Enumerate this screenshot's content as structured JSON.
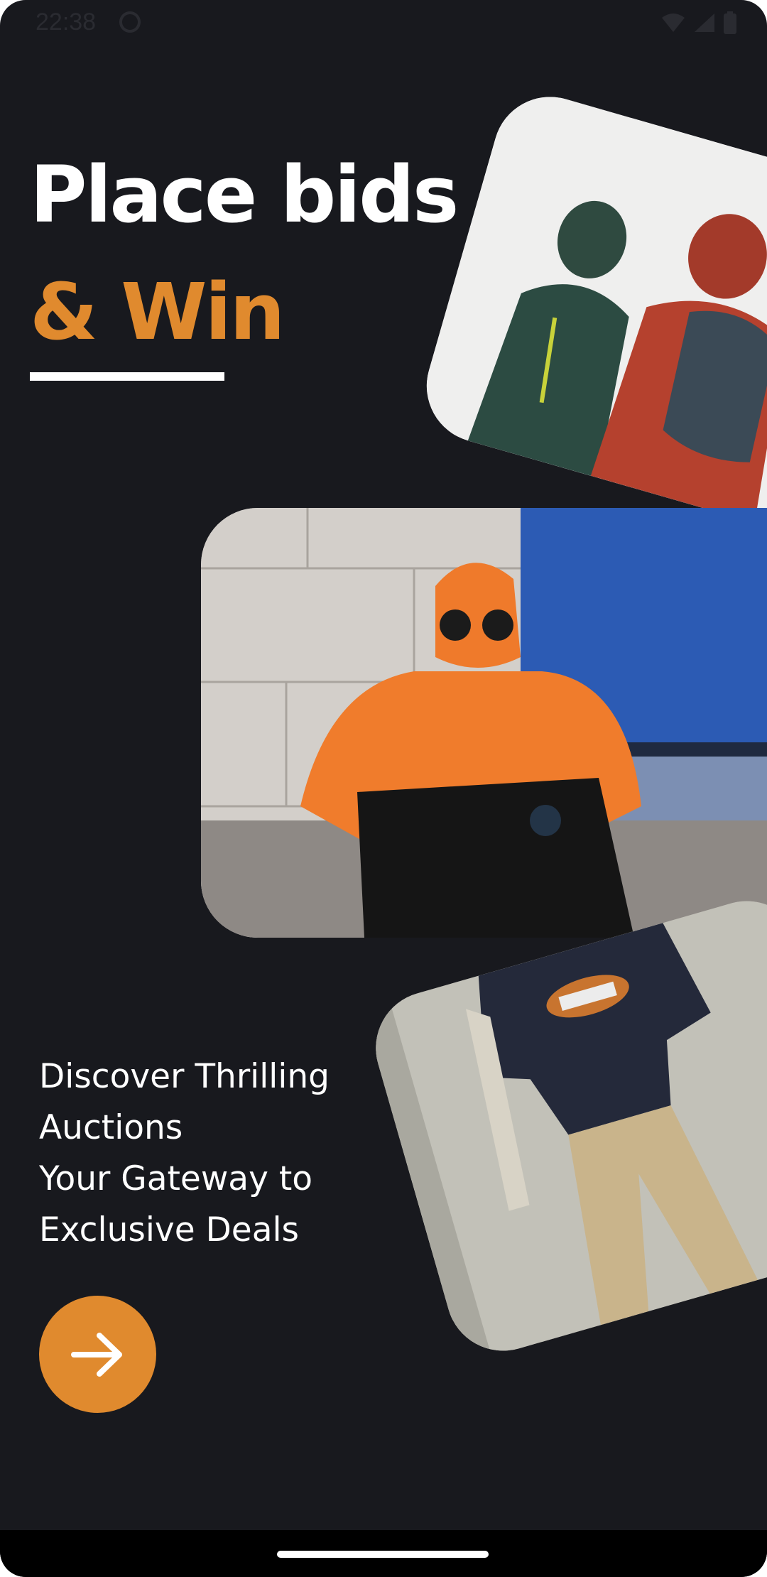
{
  "status_bar": {
    "time": "22:38",
    "icons": [
      "app-notification-icon",
      "wifi-icon",
      "cellular-signal-icon",
      "battery-icon"
    ]
  },
  "headline": {
    "line1": "Place bids",
    "line2": "& Win"
  },
  "tagline": {
    "line1": "Discover Thrilling",
    "line2": "Auctions",
    "line3": "Your Gateway to",
    "line4": "Exclusive Deals"
  },
  "next_button": {
    "icon": "arrow-right-icon"
  },
  "colors": {
    "background": "#18191e",
    "accent": "#e08a2e",
    "text": "#ffffff"
  }
}
